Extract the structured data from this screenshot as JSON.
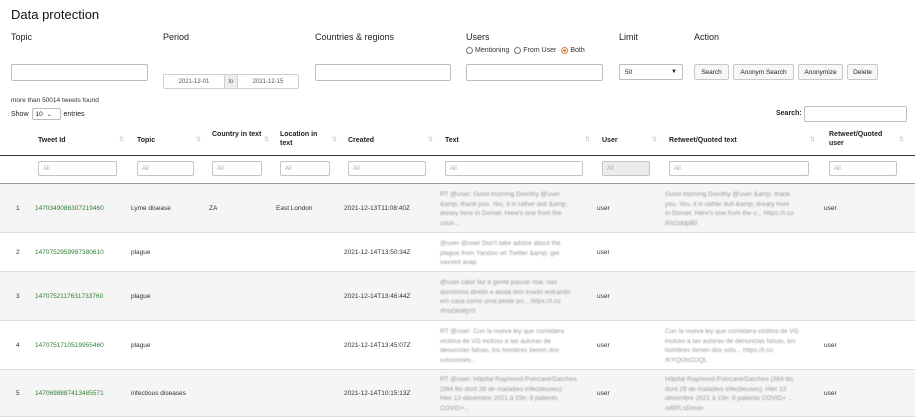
{
  "page_title": "Data protection",
  "labels": {
    "topic": "Topic",
    "period": "Period",
    "countries": "Countries & regions",
    "users": "Users",
    "limit": "Limit",
    "action": "Action"
  },
  "users_radio": {
    "options": [
      "Mentioning",
      "From User",
      "Both"
    ],
    "selected_index": 2
  },
  "period": {
    "from": "2021-12-01",
    "to_label": "to",
    "to": "2021-12-15"
  },
  "limit": {
    "value": "50"
  },
  "buttons": {
    "search": "Search",
    "anonym_search": "Anonym Search",
    "anonymize": "Anonymize",
    "delete": "Delete"
  },
  "info_text": "more than 50014 tweets found",
  "show": {
    "prefix": "Show",
    "value": "10",
    "suffix": "entries"
  },
  "search_label": "Search:",
  "columns": [
    "Tweet Id",
    "Topic",
    "Country in text",
    "Location in text",
    "Created",
    "Text",
    "User",
    "Retweet/Quoted text",
    "Retweet/Quoted user"
  ],
  "filter_placeholder": "All",
  "rows": [
    {
      "n": "1",
      "tweet_id": "1470349086307219460",
      "topic": "Lyme disease",
      "country": "ZA",
      "location": "East London",
      "created": "2021-12-13T11:08:40Z",
      "text": [
        "RT @user: Good morning Dorothy @user",
        "&amp; thank you. Yes, it is rather dull &amp;",
        "dreary here in Dorset. Here's one from the",
        "coun..."
      ],
      "user": "user",
      "rt_text": [
        "Good morning Dorothy @user &amp; thank",
        "you. Yes, it is rather dull &amp; dreary here",
        "in Dorset. Here's one from the c... https://t.co",
        "/l0z2ddpB0"
      ],
      "rt_user": "user"
    },
    {
      "n": "2",
      "tweet_id": "1470752959997380610",
      "topic": "plague",
      "country": "",
      "location": "",
      "created": "2021-12-14T13:50:34Z",
      "text": [
        "@user @user Don't take advice about the",
        "plague from Yandoo on Twitter &amp; get",
        "vaxxed asap"
      ],
      "user": "user",
      "rt_text": [],
      "rt_user": ""
    },
    {
      "n": "3",
      "tweet_id": "1470752117631733760",
      "topic": "plague",
      "country": "",
      "location": "",
      "created": "2021-12-14T13:46:44Z",
      "text": [
        "@user calor faz a gente passar mal, nao",
        "dormimos direito e ainda tem inseto entrando",
        "em casa como uma peste po... https://t.co",
        "/PmDkMIjYli"
      ],
      "user": "user",
      "rt_text": [],
      "rt_user": ""
    },
    {
      "n": "4",
      "tweet_id": "1470751710519955460",
      "topic": "plague",
      "country": "",
      "location": "",
      "created": "2021-12-14T13:45:07Z",
      "text": [
        "RT @user: Con la nueva ley que considera",
        "víctima de VG incluso a las autoras de",
        "denuncias falsas, los hombres tienen dos",
        "soluciones..."
      ],
      "user": "user",
      "rt_text": [
        "Con la nueva ley que considera víctima de VG",
        "incluso a las autoras de denuncias falsas, los",
        "hombres tienen dos solu... https://t.co",
        "/KYQOhCUQL"
      ],
      "rt_user": "user"
    },
    {
      "n": "5",
      "tweet_id": "1470698887413485571",
      "topic": "infectious diseases",
      "country": "",
      "location": "",
      "created": "2021-12-14T10:15:13Z",
      "text": [
        "RT @user: Hôpital Raymond Poincaré/Garches",
        "(384 lits dont 28 de maladies infectieuses):",
        "Hier 13 décembre 2021 à 15h: 8 patients",
        "COVID+..."
      ],
      "user": "user",
      "rt_text": [
        "Hôpital Raymond Poincaré/Garches (384 lits",
        "dont 28 de maladies infectieuses): Hier 13",
        "décembre 2021 à 15h: 8 patients COVID+ ...",
        "/eBPLsDmon"
      ],
      "rt_user": "user"
    }
  ]
}
